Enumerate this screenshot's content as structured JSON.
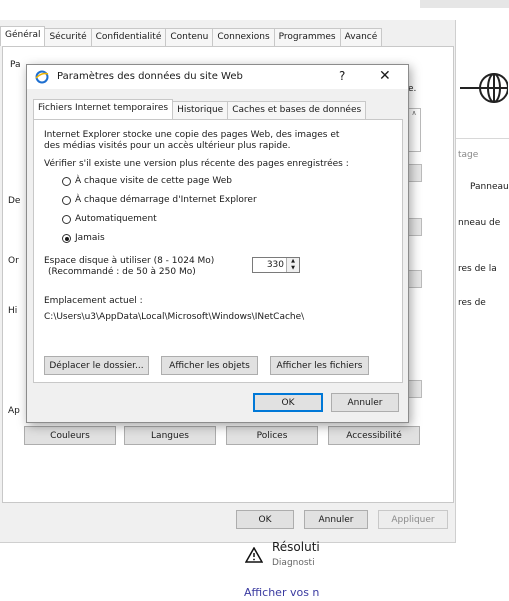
{
  "background": {
    "texts": [
      "tage",
      "Panneau",
      "nneau de",
      "res de la",
      "res de"
    ],
    "resolution": "Résoluti",
    "diagnostic": "Diagnosti",
    "afficher": "Afficher vos n"
  },
  "main_window": {
    "tabs": [
      "Général",
      "Sécurité",
      "Confidentialité",
      "Contenu",
      "Connexions",
      "Programmes",
      "Avancé"
    ],
    "active_tab": "Général",
    "edge_labels": [
      "Pa",
      "De",
      "Or",
      "Hi",
      "Ap"
    ],
    "edge_suffix": "e.",
    "bottom_buttons": [
      "Couleurs",
      "Langues",
      "Polices",
      "Accessibilité"
    ],
    "ok": "OK",
    "cancel": "Annuler",
    "apply": "Appliquer"
  },
  "dialog": {
    "title": "Paramètres des données du site Web",
    "help": "?",
    "close": "✕",
    "tabs": [
      "Fichiers Internet temporaires",
      "Historique",
      "Caches et bases de données"
    ],
    "active_tab": "Fichiers Internet temporaires",
    "intro_line1": "Internet Explorer stocke une copie des pages Web, des images et",
    "intro_line2": "des médias visités pour un accès ultérieur plus rapide.",
    "check_label": "Vérifier s'il existe une version plus récente des pages enregistrées :",
    "radios": [
      {
        "label": "À chaque visite de cette page Web",
        "selected": false
      },
      {
        "label": "À chaque démarrage d'Internet Explorer",
        "selected": false
      },
      {
        "label": "Automatiquement",
        "selected": false
      },
      {
        "label": "Jamais",
        "selected": true
      }
    ],
    "disk_label1": "Espace disque à utiliser (8 - 1024 Mo)",
    "disk_label2": "(Recommandé : de 50 à 250 Mo)",
    "disk_value": "330",
    "location_label": "Emplacement actuel :",
    "location_path": "C:\\Users\\u3\\AppData\\Local\\Microsoft\\Windows\\INetCache\\",
    "buttons": {
      "move": "Déplacer le dossier...",
      "objects": "Afficher les objets",
      "files": "Afficher les fichiers",
      "ok": "OK",
      "cancel": "Annuler"
    }
  }
}
